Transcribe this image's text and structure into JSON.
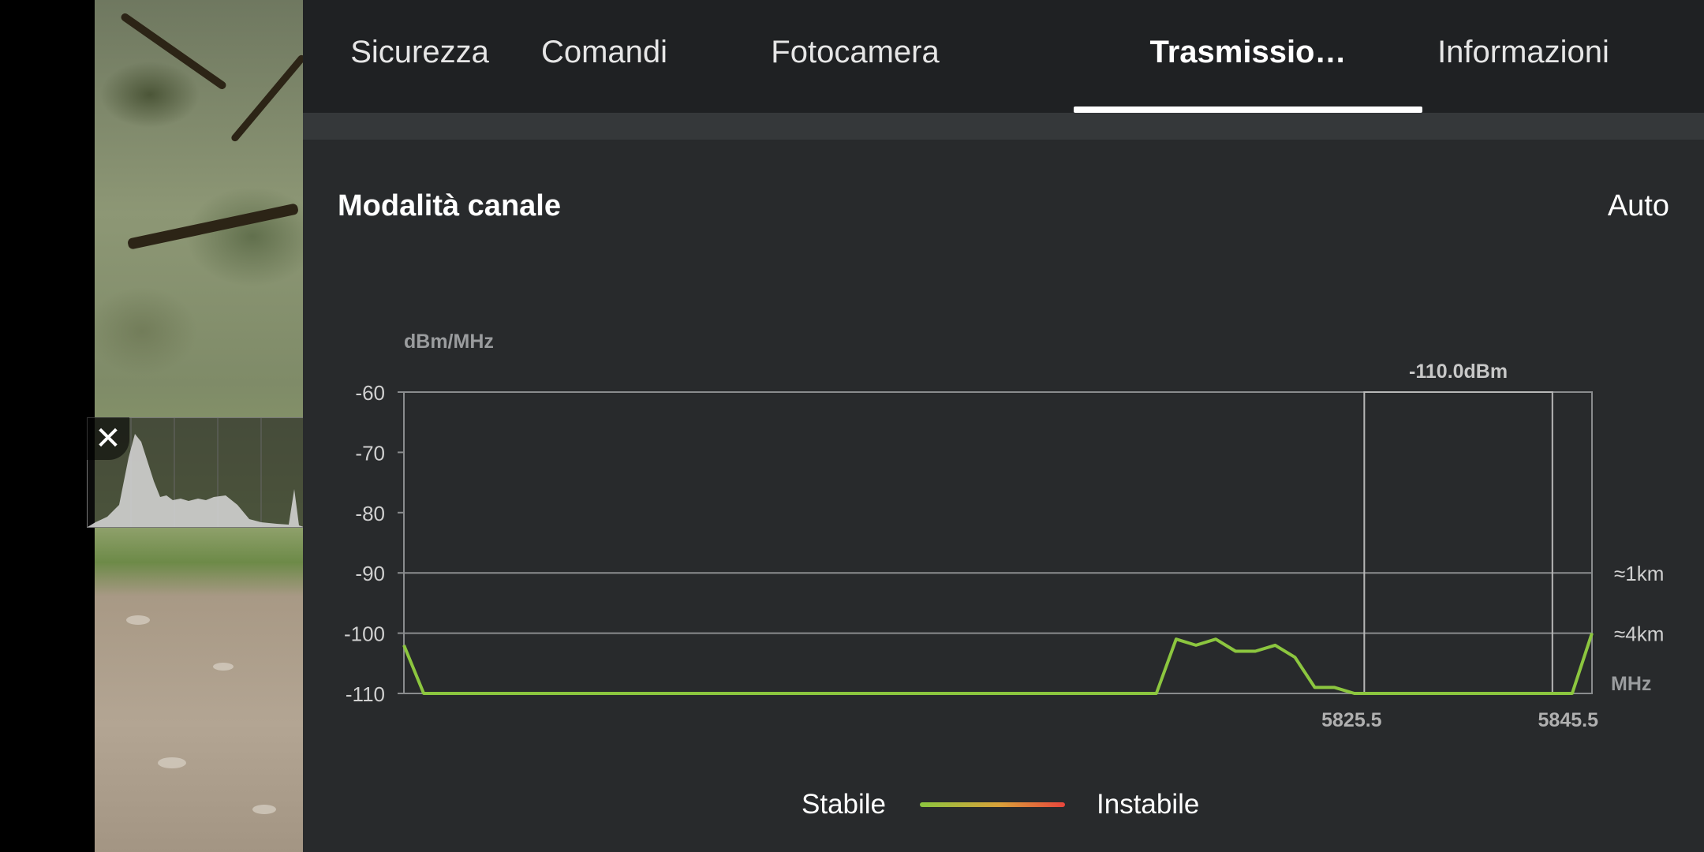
{
  "tabs": [
    {
      "label": "Sicurezza",
      "active": false
    },
    {
      "label": "Comandi",
      "active": false
    },
    {
      "label": "Fotocamera",
      "active": false
    },
    {
      "label": "Trasmissio…",
      "active": true
    },
    {
      "label": "Informazioni",
      "active": false
    }
  ],
  "channel_mode": {
    "label": "Modalità canale",
    "value": "Auto"
  },
  "histogram": {
    "close_icon": "close-icon",
    "close_symbol": "✕"
  },
  "chart_data": {
    "type": "line",
    "ylabel": "dBm/MHz",
    "xlabel": "MHz",
    "ylim": [
      -110,
      -60
    ],
    "y_ticks": [
      "-60",
      "-70",
      "-80",
      "-90",
      "-100",
      "-110"
    ],
    "x_tick_labels": [
      "5825.5",
      "5845.5"
    ],
    "x_range_index": [
      0,
      60
    ],
    "range_markers": [
      {
        "label": "≈1km",
        "y": -90
      },
      {
        "label": "≈4km",
        "y": -100
      }
    ],
    "selected_channel": {
      "label": "-110.0dBm",
      "x_from_index": 48.5,
      "x_to_index": 58
    },
    "series": [
      {
        "color": "#8cc63f",
        "values": [
          -102,
          -110,
          -110,
          -110,
          -110,
          -110,
          -110,
          -110,
          -110,
          -110,
          -110,
          -110,
          -110,
          -110,
          -110,
          -110,
          -110,
          -110,
          -110,
          -110,
          -110,
          -110,
          -110,
          -110,
          -110,
          -110,
          -110,
          -110,
          -110,
          -110,
          -110,
          -110,
          -110,
          -110,
          -110,
          -110,
          -110,
          -110,
          -110,
          -101,
          -102,
          -101,
          -103,
          -103,
          -102,
          -104,
          -109,
          -109,
          -110,
          -110,
          -110,
          -110,
          -110,
          -110,
          -110,
          -110,
          -110,
          -110,
          -110,
          -110,
          -100
        ]
      }
    ]
  },
  "legend": {
    "stable": "Stabile",
    "unstable": "Instabile"
  },
  "colors": {
    "stable": "#8cc63f",
    "unstable": "#e8453c",
    "grid": "#8a8c8e"
  }
}
